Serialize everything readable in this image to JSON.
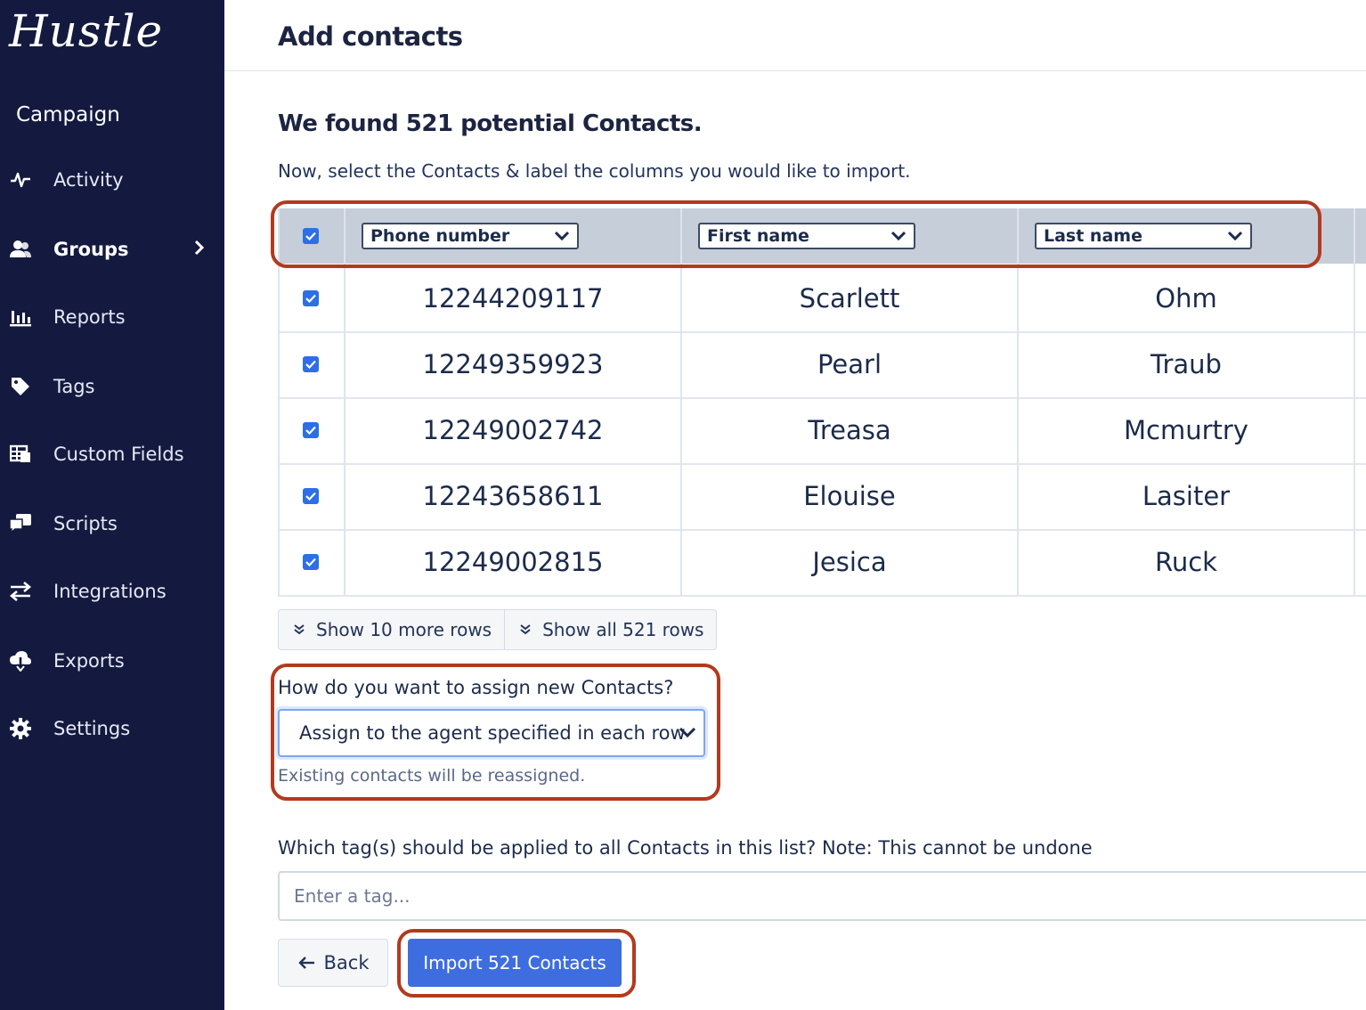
{
  "app": {
    "logo": "Hustle"
  },
  "sidebar": {
    "section_title": "Campaign",
    "items": [
      {
        "label": "Activity",
        "icon": "activity-icon"
      },
      {
        "label": "Groups",
        "icon": "users-icon",
        "active": true
      },
      {
        "label": "Reports",
        "icon": "bar-chart-icon"
      },
      {
        "label": "Tags",
        "icon": "tag-icon"
      },
      {
        "label": "Custom Fields",
        "icon": "table-icon"
      },
      {
        "label": "Scripts",
        "icon": "chat-icon"
      },
      {
        "label": "Integrations",
        "icon": "swap-icon"
      },
      {
        "label": "Exports",
        "icon": "cloud-download-icon"
      },
      {
        "label": "Settings",
        "icon": "gear-icon"
      }
    ]
  },
  "header": {
    "title": "Add contacts"
  },
  "import": {
    "found_text": "We found 521 potential Contacts.",
    "subtitle": "Now, select the Contacts & label the columns you would like to import.",
    "columns": [
      "Phone number",
      "First name",
      "Last name"
    ],
    "rows": [
      {
        "phone": "12244209117",
        "first": "Scarlett",
        "last": "Ohm"
      },
      {
        "phone": "12249359923",
        "first": "Pearl",
        "last": "Traub"
      },
      {
        "phone": "12249002742",
        "first": "Treasa",
        "last": "Mcmurtry"
      },
      {
        "phone": "12243658611",
        "first": "Elouise",
        "last": "Lasiter"
      },
      {
        "phone": "12249002815",
        "first": "Jesica",
        "last": "Ruck"
      }
    ],
    "show_more_label": "Show 10 more rows",
    "show_all_label": "Show all 521 rows"
  },
  "assign": {
    "label": "How do you want to assign new Contacts?",
    "selected": "Assign to the agent specified in each row",
    "help": "Existing contacts will be reassigned."
  },
  "tags": {
    "label": "Which tag(s) should be applied to all Contacts in this list? Note: This cannot be undone",
    "placeholder": "Enter a tag..."
  },
  "actions": {
    "back_label": "Back",
    "import_label": "Import 521 Contacts"
  },
  "colors": {
    "sidebar": "#141a3f",
    "accent": "#3e6ddf",
    "highlight": "#b23a1e",
    "header_row": "#c6ceda"
  }
}
